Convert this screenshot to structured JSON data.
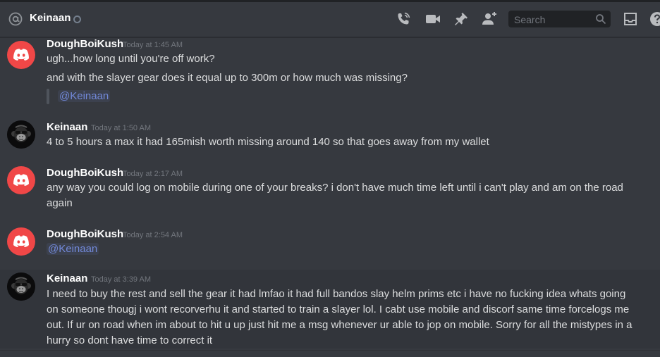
{
  "header": {
    "channel_name": "Keinaan",
    "search_placeholder": "Search"
  },
  "icons": {
    "at": "at-icon",
    "status": "status-offline-icon",
    "call": "phone-call-icon",
    "video": "video-camera-icon",
    "pin": "pin-icon",
    "add_user": "add-friend-icon",
    "search": "search-icon",
    "inbox": "inbox-icon",
    "help": "help-icon"
  },
  "colors": {
    "background": "#36393f",
    "username": "#ffffff",
    "timestamp": "#72767d",
    "mention": "#7289da",
    "discord_avatar": "#f04747"
  },
  "messages": [
    {
      "author": "DoughBoiKush",
      "timestamp": "Today at 1:45 AM",
      "lines": [
        "ugh...how long until you're off work?",
        "and with the slayer gear does it equal up to 300m or how much was missing?"
      ],
      "quote_mention": "@Keinaan"
    },
    {
      "author": "Keinaan",
      "timestamp": "Today at 1:50 AM",
      "lines": [
        "4 to 5 hours a max it had 165mish worth missing around 140 so that goes away from my wallet"
      ]
    },
    {
      "author": "DoughBoiKush",
      "timestamp": "Today at 2:17 AM",
      "lines": [
        "any way you could log on mobile during one of your breaks? i don't have much time left until i can't play and am on the road again"
      ]
    },
    {
      "author": "DoughBoiKush",
      "timestamp": "Today at 2:54 AM",
      "mention": "@Keinaan"
    },
    {
      "author": "Keinaan",
      "timestamp": "Today at 3:39 AM",
      "lines": [
        "I need to buy the rest and sell the gear it had lmfao it had full bandos slay helm prims etc i have no fucking idea whats going on someone thougj i wont recorverhu it and started to train a slayer lol. I cabt use mobile and discorf same time forcelogs me out. If ur on road when im about to hit u up just hit me a msg whenever ur able to jop on mobile. Sorry for all the mistypes in a hurry so dont have time to correct it"
      ]
    }
  ]
}
